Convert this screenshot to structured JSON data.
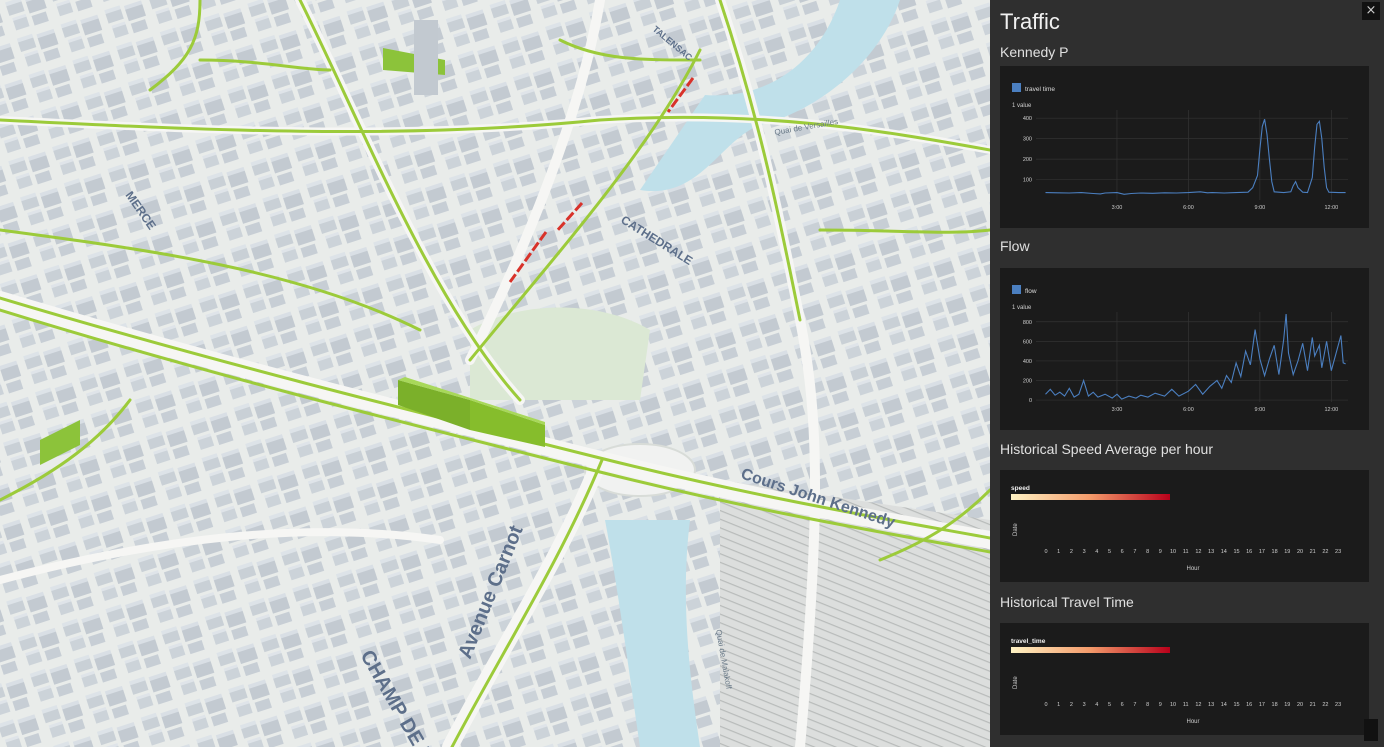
{
  "panel": {
    "title": "Traffic",
    "close_label": "×",
    "sections": {
      "travel": "Kennedy P",
      "flow": "Flow",
      "speed": "Historical Speed Average per hour",
      "ttime": "Historical Travel Time"
    }
  },
  "map": {
    "labels": [
      {
        "text": "Avenue Carnot"
      },
      {
        "text": "Cours John Kennedy"
      },
      {
        "text": "CHAMP DE M"
      },
      {
        "text": "CATHEDRALE"
      },
      {
        "text": "MERCE"
      },
      {
        "text": "TALENSAC"
      },
      {
        "text": "Quai de Versailles"
      },
      {
        "text": "Quai de Malakoff"
      }
    ]
  },
  "chart_data": [
    {
      "type": "line",
      "title": "Kennedy P",
      "ylabel": "1 value",
      "series": [
        {
          "name": "travel time",
          "color": "#4b7fc0",
          "points": [
            [
              0,
              36
            ],
            [
              0.5,
              35
            ],
            [
              1,
              34
            ],
            [
              1.5,
              36
            ],
            [
              2,
              32
            ],
            [
              2.3,
              30
            ],
            [
              2.5,
              34
            ],
            [
              3,
              36
            ],
            [
              3.3,
              28
            ],
            [
              3.6,
              32
            ],
            [
              4,
              34
            ],
            [
              4.5,
              33
            ],
            [
              5,
              35
            ],
            [
              5.5,
              34
            ],
            [
              6,
              36
            ],
            [
              6.5,
              40
            ],
            [
              6.8,
              35
            ],
            [
              7,
              36
            ],
            [
              7.5,
              34
            ],
            [
              8,
              36
            ],
            [
              8.5,
              38
            ],
            [
              8.7,
              60
            ],
            [
              8.9,
              120
            ],
            [
              9.0,
              250
            ],
            [
              9.1,
              360
            ],
            [
              9.2,
              395
            ],
            [
              9.3,
              320
            ],
            [
              9.4,
              200
            ],
            [
              9.5,
              90
            ],
            [
              9.6,
              40
            ],
            [
              10,
              36
            ],
            [
              10.3,
              40
            ],
            [
              10.4,
              70
            ],
            [
              10.5,
              90
            ],
            [
              10.6,
              60
            ],
            [
              10.8,
              38
            ],
            [
              11,
              36
            ],
            [
              11.2,
              110
            ],
            [
              11.3,
              260
            ],
            [
              11.4,
              370
            ],
            [
              11.5,
              385
            ],
            [
              11.6,
              300
            ],
            [
              11.7,
              160
            ],
            [
              11.8,
              60
            ],
            [
              11.9,
              38
            ],
            [
              12.3,
              36
            ],
            [
              12.6,
              36
            ]
          ]
        }
      ],
      "xticks": [
        {
          "value": 3,
          "label": "3:00"
        },
        {
          "value": 6,
          "label": "6:00"
        },
        {
          "value": 9,
          "label": "9:00"
        },
        {
          "value": 12,
          "label": "12:00"
        }
      ],
      "yticks": [
        100,
        200,
        300,
        400
      ],
      "xlim": [
        -0.4,
        12.7
      ],
      "ylim": [
        0,
        440
      ]
    },
    {
      "type": "line",
      "title": "Flow",
      "ylabel": "1 value",
      "series": [
        {
          "name": "flow",
          "color": "#4b7fc0",
          "points": [
            [
              0,
              60
            ],
            [
              0.2,
              110
            ],
            [
              0.4,
              50
            ],
            [
              0.6,
              80
            ],
            [
              0.8,
              40
            ],
            [
              1.0,
              120
            ],
            [
              1.2,
              30
            ],
            [
              1.4,
              60
            ],
            [
              1.6,
              200
            ],
            [
              1.8,
              40
            ],
            [
              2.0,
              80
            ],
            [
              2.2,
              30
            ],
            [
              2.5,
              60
            ],
            [
              2.8,
              20
            ],
            [
              3.0,
              60
            ],
            [
              3.2,
              10
            ],
            [
              3.5,
              40
            ],
            [
              3.8,
              20
            ],
            [
              4,
              50
            ],
            [
              4.3,
              30
            ],
            [
              4.6,
              70
            ],
            [
              5,
              40
            ],
            [
              5.3,
              110
            ],
            [
              5.6,
              40
            ],
            [
              6,
              90
            ],
            [
              6.3,
              160
            ],
            [
              6.6,
              60
            ],
            [
              6.9,
              140
            ],
            [
              7.2,
              200
            ],
            [
              7.4,
              120
            ],
            [
              7.6,
              250
            ],
            [
              7.8,
              180
            ],
            [
              8.0,
              380
            ],
            [
              8.2,
              240
            ],
            [
              8.4,
              500
            ],
            [
              8.6,
              360
            ],
            [
              8.8,
              720
            ],
            [
              9.0,
              420
            ],
            [
              9.2,
              250
            ],
            [
              9.4,
              420
            ],
            [
              9.6,
              560
            ],
            [
              9.8,
              260
            ],
            [
              10.0,
              620
            ],
            [
              10.1,
              880
            ],
            [
              10.2,
              480
            ],
            [
              10.4,
              260
            ],
            [
              10.6,
              400
            ],
            [
              10.8,
              580
            ],
            [
              11.0,
              300
            ],
            [
              11.2,
              640
            ],
            [
              11.3,
              450
            ],
            [
              11.5,
              560
            ],
            [
              11.6,
              330
            ],
            [
              11.8,
              600
            ],
            [
              12.0,
              300
            ],
            [
              12.2,
              480
            ],
            [
              12.4,
              660
            ],
            [
              12.5,
              380
            ],
            [
              12.6,
              370
            ]
          ]
        }
      ],
      "xticks": [
        {
          "value": 3,
          "label": "3:00"
        },
        {
          "value": 6,
          "label": "6:00"
        },
        {
          "value": 9,
          "label": "9:00"
        },
        {
          "value": 12,
          "label": "12:00"
        }
      ],
      "yticks": [
        0,
        200,
        400,
        600,
        800
      ],
      "xlim": [
        -0.4,
        12.7
      ],
      "ylim": [
        -20,
        900
      ]
    },
    {
      "type": "heatmap",
      "title": "Historical Speed Average per hour",
      "colorscale_label": "speed",
      "colorscale": [
        "#fff3c4",
        "#f39a6a",
        "#b8001a"
      ],
      "xlabel": "Hour",
      "ylabel": "Date",
      "xticks": [
        "0",
        "1",
        "2",
        "3",
        "4",
        "5",
        "6",
        "7",
        "8",
        "9",
        "10",
        "11",
        "12",
        "13",
        "14",
        "15",
        "16",
        "17",
        "18",
        "19",
        "20",
        "21",
        "22",
        "23"
      ]
    },
    {
      "type": "heatmap",
      "title": "Historical Travel Time",
      "colorscale_label": "travel_time",
      "colorscale": [
        "#fff3c4",
        "#f39a6a",
        "#b8001a"
      ],
      "xlabel": "Hour",
      "ylabel": "Date",
      "xticks": [
        "0",
        "1",
        "2",
        "3",
        "4",
        "5",
        "6",
        "7",
        "8",
        "9",
        "10",
        "11",
        "12",
        "13",
        "14",
        "15",
        "16",
        "17",
        "18",
        "19",
        "20",
        "21",
        "22",
        "23"
      ]
    }
  ]
}
